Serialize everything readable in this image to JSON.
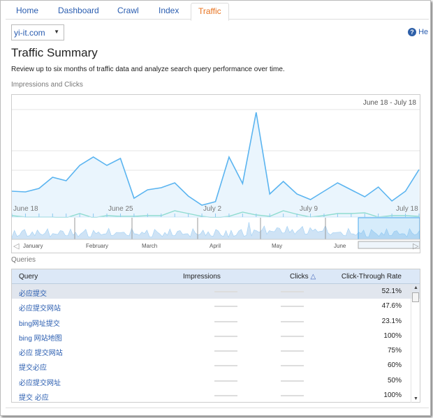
{
  "tabs": [
    {
      "label": "Home"
    },
    {
      "label": "Dashboard"
    },
    {
      "label": "Crawl"
    },
    {
      "label": "Index"
    },
    {
      "label": "Traffic",
      "active": true
    }
  ],
  "site_select": {
    "value": "yi-it.com"
  },
  "help_label": "He",
  "page_title": "Traffic Summary",
  "description": "Review up to six months of traffic data and analyze search query performance over time.",
  "chart_section_label": "Impressions and Clicks",
  "colors": {
    "impressions": "#5ab4f0",
    "clicks": "#8fdcd0",
    "accent": "#e8731f",
    "link": "#2a5db0"
  },
  "chart_data": {
    "type": "area",
    "date_range": "June 18 - July 18",
    "x_tick_labels": [
      "June 18",
      "June 25",
      "July 2",
      "July 9",
      "July 18"
    ],
    "series": [
      {
        "name": "Impressions",
        "values": [
          37,
          36,
          41,
          57,
          52,
          74,
          86,
          74,
          84,
          27,
          39,
          42,
          49,
          30,
          17,
          22,
          86,
          48,
          150,
          33,
          51,
          33,
          25,
          37,
          49,
          39,
          29,
          43,
          23,
          37,
          68
        ]
      },
      {
        "name": "Clicks",
        "values": [
          5,
          3,
          3,
          3,
          2,
          8,
          2,
          5,
          4,
          4,
          5,
          5,
          12,
          8,
          4,
          2,
          4,
          10,
          6,
          4,
          12,
          7,
          3,
          5,
          8,
          8,
          9,
          3,
          5,
          5,
          4
        ]
      }
    ],
    "navigator_months": [
      "January",
      "February",
      "March",
      "April",
      "May",
      "June"
    ],
    "grid": true
  },
  "queries_label": "Queries",
  "table": {
    "columns": [
      "Query",
      "Impressions",
      "Clicks",
      "Click-Through Rate"
    ],
    "sort_indicator": "△",
    "rows": [
      {
        "query": "必应提交",
        "ctr": "52.1%"
      },
      {
        "query": "必应提交网站",
        "ctr": "47.6%"
      },
      {
        "query": "bing网址提交",
        "ctr": "23.1%"
      },
      {
        "query": "bing 网站地图",
        "ctr": "100%"
      },
      {
        "query": "必应 提交网站",
        "ctr": "75%"
      },
      {
        "query": "提交必应",
        "ctr": "60%"
      },
      {
        "query": "必应提交网址",
        "ctr": "50%"
      },
      {
        "query": "提交 必应",
        "ctr": "100%"
      }
    ]
  }
}
